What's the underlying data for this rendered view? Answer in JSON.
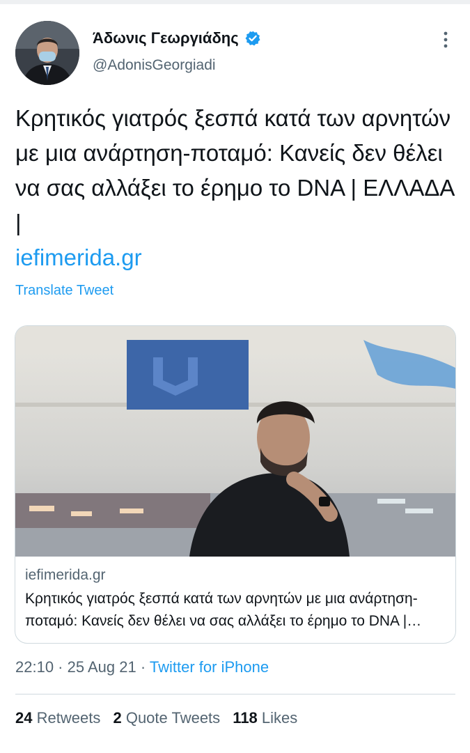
{
  "author": {
    "display_name": "Άδωνις Γεωργιάδης",
    "handle": "@AdonisGeorgiadi",
    "verified": true,
    "verified_icon": "verified-badge-icon",
    "avatar_icon": "profile-photo",
    "more_icon": "more-options-icon"
  },
  "tweet": {
    "text": "Κρητικός γιατρός ξεσπά κατά των αρνητών με μια ανάρτηση-ποταμό: Κανείς δεν θέλει να σας αλλάξει το έρημο το DNA | ΕΛΛΑΔΑ |",
    "link": "iefimerida.gr",
    "translate_label": "Translate Tweet"
  },
  "card": {
    "domain": "iefimerida.gr",
    "title": "Κρητικός γιατρός ξεσπά κατά των αρνητών με μια ανάρτηση-ποταμό: Κανείς δεν θέλει να σας αλλάξει το έρημο το DNA | ΕΛΛΑΔΑ |",
    "image_icon": "article-photo"
  },
  "meta": {
    "time": "22:10",
    "separator1": " · ",
    "date": "25 Aug 21",
    "separator2": " · ",
    "source": "Twitter for iPhone"
  },
  "stats": {
    "retweets_count": "24",
    "retweets_label": "Retweets",
    "quotes_count": "2",
    "quotes_label": "Quote Tweets",
    "likes_count": "118",
    "likes_label": "Likes"
  },
  "colors": {
    "accent": "#1d9bf0",
    "text": "#0f1419",
    "secondary": "#536471",
    "border": "#cfd9de"
  }
}
